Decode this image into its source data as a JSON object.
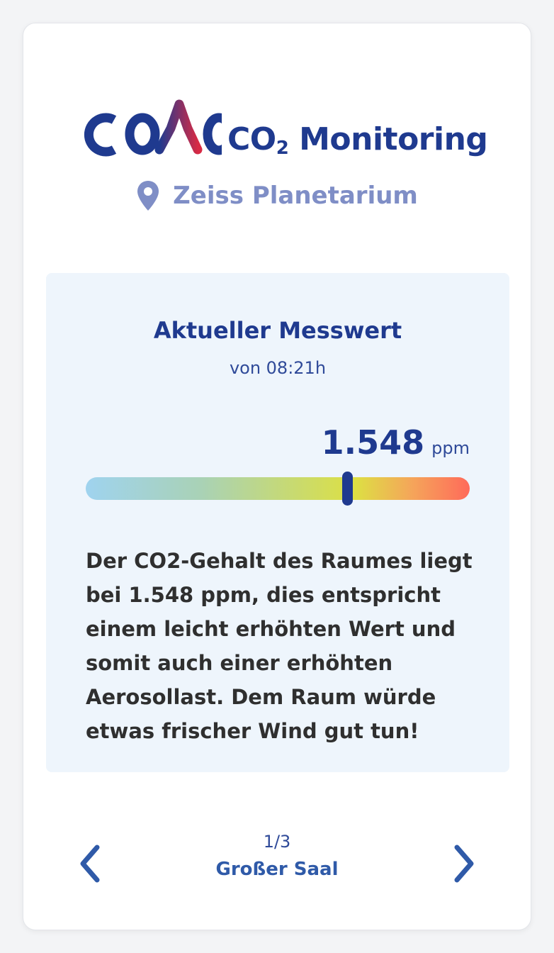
{
  "brand": {
    "logo_text": "COMO",
    "title_prefix": "CO",
    "title_subscript": "2",
    "title_suffix": " Monitoring",
    "color_primary": "#1f3a8f",
    "color_accent": "#d72a45"
  },
  "location": {
    "icon": "map-pin-icon",
    "name": "Zeiss Planetarium"
  },
  "measurement": {
    "title": "Aktueller Messwert",
    "time": "von 08:21h",
    "value": "1.548",
    "unit": "ppm",
    "gauge_position_fraction": 0.68,
    "description": "Der CO2-Gehalt des Raumes liegt bei 1.548 ppm, dies entspricht einem leicht erhöhten Wert und somit auch einer erhöhten Aerosollast. Dem Raum würde etwas frischer Wind gut tun!"
  },
  "pager": {
    "prev_icon": "chevron-left-icon",
    "next_icon": "chevron-right-icon",
    "count": "1/3",
    "room": "Großer Saal"
  }
}
